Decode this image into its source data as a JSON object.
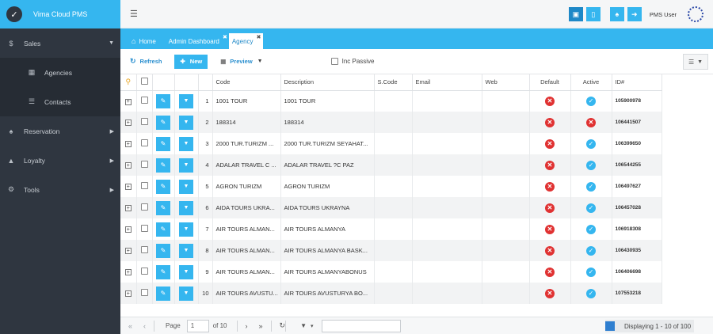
{
  "sidebar": {
    "brand": "Vima Cloud PMS",
    "items": [
      {
        "label": "Sales",
        "icon": "dollar-icon",
        "level": "top",
        "expanded": true
      },
      {
        "label": "Agencies",
        "icon": "building-icon",
        "level": "sub"
      },
      {
        "label": "Contacts",
        "icon": "list-icon",
        "level": "sub"
      },
      {
        "label": "Reservation",
        "icon": "bell-icon",
        "level": "top",
        "expanded": false
      },
      {
        "label": "Loyalty",
        "icon": "thumbs-up-icon",
        "level": "top",
        "expanded": false
      },
      {
        "label": "Tools",
        "icon": "gears-icon",
        "level": "top",
        "expanded": false
      }
    ]
  },
  "header": {
    "user": "PMS User"
  },
  "tabs": [
    {
      "label": "Home",
      "active": false,
      "closable": false
    },
    {
      "label": "Admin Dashboard",
      "active": false,
      "closable": true
    },
    {
      "label": "Agency",
      "active": true,
      "closable": true
    }
  ],
  "toolbar": {
    "refresh": "Refresh",
    "new": "New",
    "preview": "Preview",
    "inc_passive": "Inc Passive"
  },
  "grid": {
    "columns": {
      "code": "Code",
      "description": "Description",
      "scode": "S.Code",
      "email": "Email",
      "web": "Web",
      "default": "Default",
      "active": "Active",
      "id": "ID#"
    },
    "rows": [
      {
        "n": "1",
        "code": "1001 TOUR",
        "description": "1001 TOUR",
        "active": true,
        "id": "105900978"
      },
      {
        "n": "2",
        "code": "188314",
        "description": "188314",
        "active": false,
        "id": "106441507"
      },
      {
        "n": "3",
        "code": "2000 TUR.TURIZM ...",
        "description": "2000 TUR.TURIZM SEYAHAT...",
        "active": true,
        "id": "106399650"
      },
      {
        "n": "4",
        "code": "ADALAR TRAVEL C ...",
        "description": "ADALAR TRAVEL ?C PAZ",
        "active": true,
        "id": "106544255"
      },
      {
        "n": "5",
        "code": "AGRON TURIZM",
        "description": "AGRON TURIZM",
        "active": true,
        "id": "106497627"
      },
      {
        "n": "6",
        "code": "AIDA TOURS UKRA...",
        "description": "AIDA TOURS UKRAYNA",
        "active": true,
        "id": "106457028"
      },
      {
        "n": "7",
        "code": "AIR TOURS ALMAN...",
        "description": "AIR TOURS ALMANYA",
        "active": true,
        "id": "106918308"
      },
      {
        "n": "8",
        "code": "AIR TOURS ALMAN...",
        "description": "AIR TOURS ALMANYA BASK...",
        "active": true,
        "id": "106430935"
      },
      {
        "n": "9",
        "code": "AIR TOURS ALMAN...",
        "description": "AIR TOURS ALMANYABONUS",
        "active": true,
        "id": "106406698"
      },
      {
        "n": "10",
        "code": "AIR TOURS AVUSTU...",
        "description": "AIR TOURS AVUSTURYA BO...",
        "active": true,
        "id": "107553218"
      }
    ]
  },
  "pager": {
    "page_label": "Page",
    "page_value": "1",
    "of_label": "of 10",
    "displaying": "Displaying 1 - 10 of 100"
  },
  "colors": {
    "accent": "#35b6ef",
    "sidebar": "#2f3640",
    "danger": "#e03232"
  }
}
